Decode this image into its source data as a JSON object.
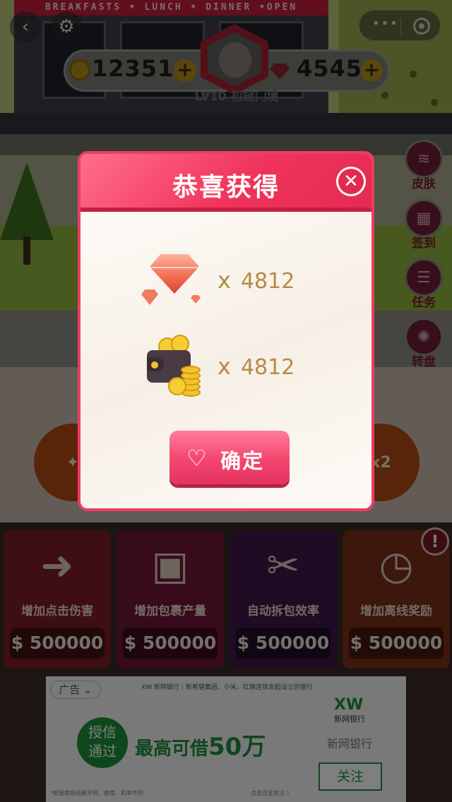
{
  "scene": {
    "shop_sign": "BREAKFASTS • LUNCH • DINNER •OPEN"
  },
  "hud": {
    "back_icon": "chevron-left-icon",
    "settings_icon": "gear-icon",
    "coins": "12351",
    "gems": "4545",
    "level": "LV10 初窥门境"
  },
  "side_menu": [
    {
      "label": "皮肤",
      "icon": "layers-icon"
    },
    {
      "label": "签到",
      "icon": "calendar-check-icon"
    },
    {
      "label": "任务",
      "icon": "checklist-icon"
    },
    {
      "label": "转盘",
      "icon": "wheel-icon"
    }
  ],
  "orbs": {
    "right_label": "x2"
  },
  "modal": {
    "title": "恭喜获得",
    "rewards": [
      {
        "icon": "gem-icon",
        "prefix": "x",
        "amount": "4812"
      },
      {
        "icon": "wallet-coins-icon",
        "prefix": "x",
        "amount": "4812"
      }
    ],
    "confirm_label": "确定",
    "accent": "#ee3c63"
  },
  "upgrades": [
    {
      "title": "增加点击伤害",
      "price": "$ 500000",
      "color": "#7a1f24"
    },
    {
      "title": "增加包裹产量",
      "price": "$ 500000",
      "color": "#6e1438"
    },
    {
      "title": "自动拆包效率",
      "price": "$ 500000",
      "color": "#3e1848"
    },
    {
      "title": "增加离线奖励",
      "price": "$ 500000",
      "color": "#7a2c18"
    }
  ],
  "ad": {
    "tag": "广告",
    "top_text": "XW 新网银行｜新希望集团、小米、红旗连锁发起设立的银行",
    "circle_text_1": "授信",
    "circle_text_2": "通过",
    "headline_prefix": "最高可借",
    "headline_amount": "50万",
    "brand_logo": "XW",
    "brand_small": "新网银行",
    "brand_name": "新网银行",
    "follow_label": "关注",
    "foot_left": "*根据审核结果不同，额度、利率不同",
    "foot_right": "点击否定关注 〉"
  }
}
